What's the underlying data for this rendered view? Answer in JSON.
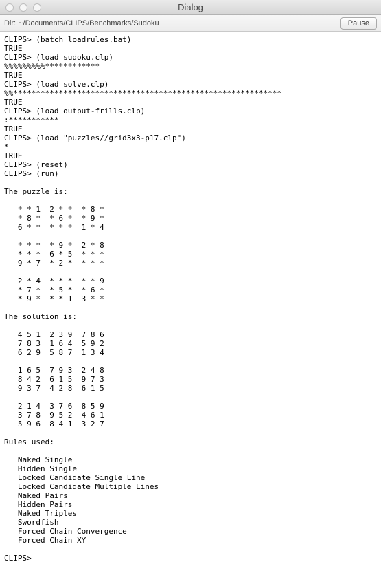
{
  "window": {
    "title": "Dialog"
  },
  "toolbar": {
    "dir_label": "Dir:",
    "dir_path": "~/Documents/CLIPS/Benchmarks/Sudoku",
    "pause_label": "Pause"
  },
  "terminal": {
    "text": "CLIPS> (batch loadrules.bat)\nTRUE\nCLIPS> (load sudoku.clp)\n%%%%%%%%%************\nTRUE\nCLIPS> (load solve.clp)\n%%***********************************************************\nTRUE\nCLIPS> (load output-frills.clp)\n:***********\nTRUE\nCLIPS> (load \"puzzles//grid3x3-p17.clp\")\n*\nTRUE\nCLIPS> (reset)\nCLIPS> (run)\n\nThe puzzle is:\n\n   * * 1  2 * *  * 8 *\n   * 8 *  * 6 *  * 9 *\n   6 * *  * * *  1 * 4\n\n   * * *  * 9 *  2 * 8\n   * * *  6 * 5  * * *\n   9 * 7  * 2 *  * * *\n\n   2 * 4  * * *  * * 9\n   * 7 *  * 5 *  * 6 *\n   * 9 *  * * 1  3 * *\n\nThe solution is:\n\n   4 5 1  2 3 9  7 8 6\n   7 8 3  1 6 4  5 9 2\n   6 2 9  5 8 7  1 3 4\n\n   1 6 5  7 9 3  2 4 8\n   8 4 2  6 1 5  9 7 3\n   9 3 7  4 2 8  6 1 5\n\n   2 1 4  3 7 6  8 5 9\n   3 7 8  9 5 2  4 6 1\n   5 9 6  8 4 1  3 2 7\n\nRules used:\n\n   Naked Single\n   Hidden Single\n   Locked Candidate Single Line\n   Locked Candidate Multiple Lines\n   Naked Pairs\n   Hidden Pairs\n   Naked Triples\n   Swordfish\n   Forced Chain Convergence\n   Forced Chain XY\n\nCLIPS> "
  }
}
